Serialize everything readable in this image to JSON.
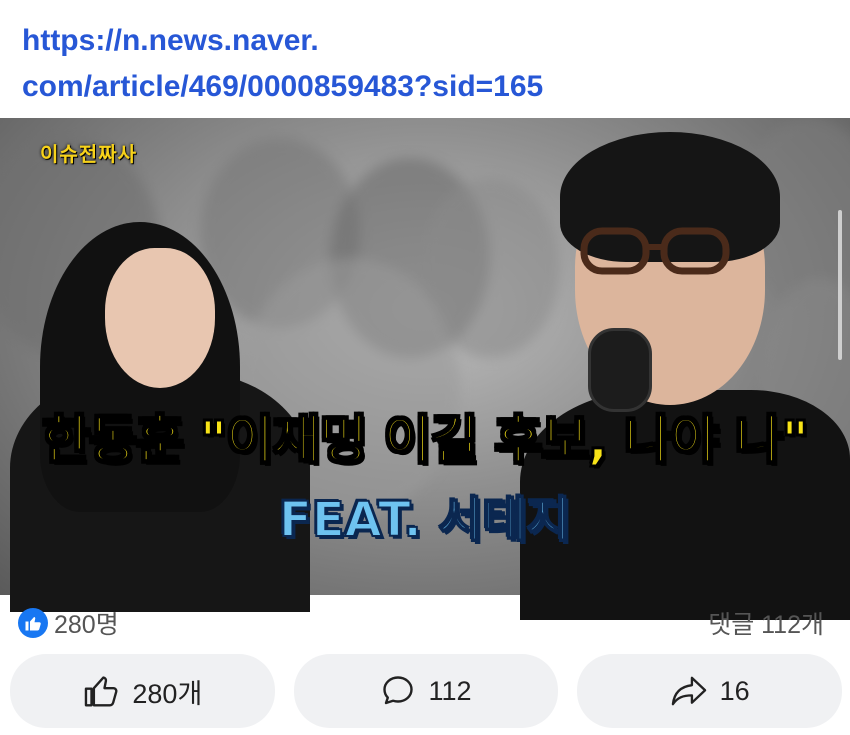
{
  "link": {
    "line1": "https://n.news.naver.",
    "line2": "com/article/469/0000859483?sid=165"
  },
  "thumbnail": {
    "logo_text": "이슈전짜사",
    "headline": "한동훈 \"이재명 이길 후보, 나야 나\"",
    "subheadline": "FEAT. 서태지"
  },
  "stats": {
    "likes": "280명",
    "comments": "댓글 112개"
  },
  "actions": {
    "like_label": "280개",
    "comment_label": "112",
    "share_label": "16"
  },
  "colors": {
    "link": "#2757d6",
    "like_badge": "#1877f2",
    "headline": "#f8e317",
    "subheadline": "#6ec3f0",
    "button_bg": "#f0f1f3"
  },
  "icons": {
    "like_badge": "thumbs-up-icon",
    "like_button": "thumbs-up-outline-icon",
    "comment_button": "speech-bubble-icon",
    "share_button": "share-arrow-icon"
  }
}
